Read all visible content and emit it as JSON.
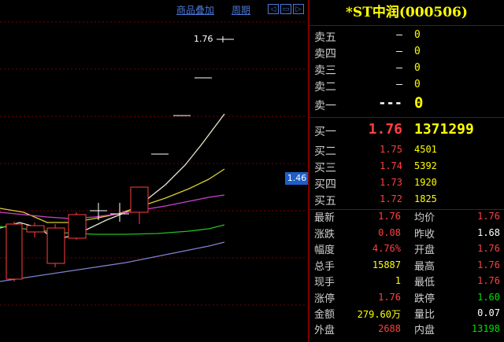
{
  "toolbar": {
    "overlay_label": "商品叠加",
    "period_label": "周期",
    "nav_left": "◁",
    "nav_mid": "▭",
    "nav_right": "▷"
  },
  "chart": {
    "high_label": "1.76",
    "current_price_tag": "1.46"
  },
  "stock": {
    "title": "*ST中润(000506)"
  },
  "sell_orders": [
    {
      "label": "卖五",
      "price": "—",
      "volume": "0"
    },
    {
      "label": "卖四",
      "price": "—",
      "volume": "0"
    },
    {
      "label": "卖三",
      "price": "—",
      "volume": "0"
    },
    {
      "label": "卖二",
      "price": "—",
      "volume": "0"
    },
    {
      "label": "卖一",
      "price": "---",
      "volume": "0"
    }
  ],
  "buy_orders": [
    {
      "label": "买一",
      "price": "1.76",
      "volume": "1371299"
    },
    {
      "label": "买二",
      "price": "1.75",
      "volume": "4501"
    },
    {
      "label": "买三",
      "price": "1.74",
      "volume": "5392"
    },
    {
      "label": "买四",
      "price": "1.73",
      "volume": "1920"
    },
    {
      "label": "买五",
      "price": "1.72",
      "volume": "1825"
    }
  ],
  "quote": [
    {
      "l1": "最新",
      "v1": "1.76",
      "c1": "#ff4040",
      "l2": "均价",
      "v2": "1.76",
      "c2": "#ff4040"
    },
    {
      "l1": "涨跌",
      "v1": "0.08",
      "c1": "#ff4040",
      "l2": "昨收",
      "v2": "1.68",
      "c2": "#ffffff"
    },
    {
      "l1": "幅度",
      "v1": "4.76%",
      "c1": "#ff4040",
      "l2": "开盘",
      "v2": "1.76",
      "c2": "#ff4040"
    },
    {
      "l1": "总手",
      "v1": "15887",
      "c1": "#ffff00",
      "l2": "最高",
      "v2": "1.76",
      "c2": "#ff4040"
    },
    {
      "l1": "现手",
      "v1": "1",
      "c1": "#ffff00",
      "l2": "最低",
      "v2": "1.76",
      "c2": "#ff4040"
    },
    {
      "l1": "涨停",
      "v1": "1.76",
      "c1": "#ff4040",
      "l2": "跌停",
      "v2": "1.60",
      "c2": "#00e000"
    },
    {
      "l1": "金额",
      "v1": "279.60万",
      "c1": "#ffff00",
      "l2": "量比",
      "v2": "0.07",
      "c2": "#ffffff"
    },
    {
      "l1": "外盘",
      "v1": "2688",
      "c1": "#ff4040",
      "l2": "内盘",
      "v2": "13198",
      "c2": "#00e000"
    }
  ],
  "colors": {
    "up": "#ff4040",
    "down": "#00e000",
    "highlight": "#ffff00",
    "accent": "#1d5fc8",
    "separator": "#8a0000"
  }
}
